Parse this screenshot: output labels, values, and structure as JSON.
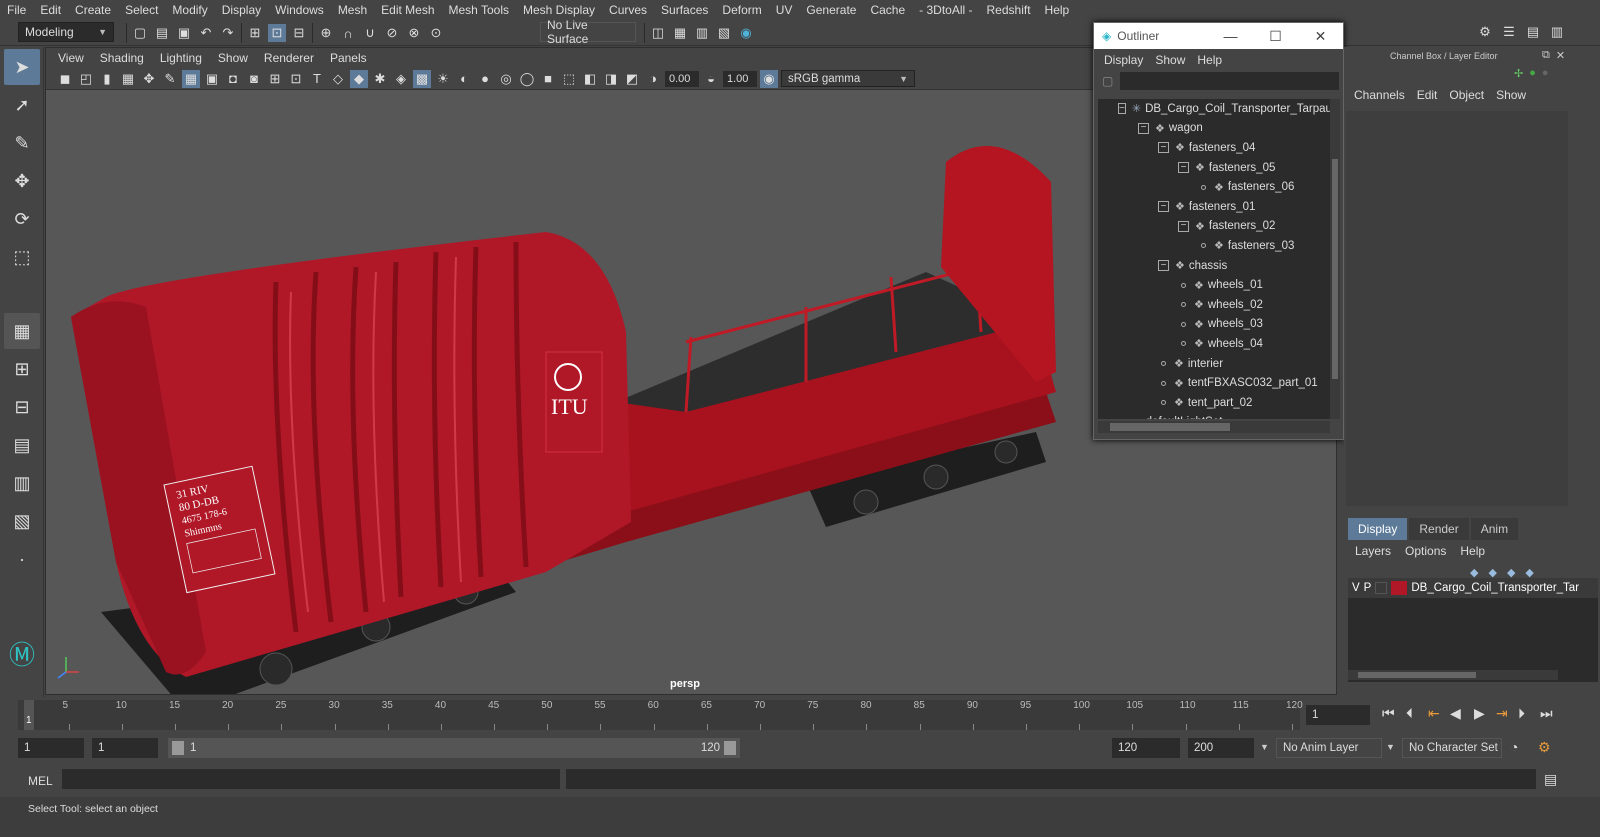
{
  "menubar": {
    "items": [
      "File",
      "Edit",
      "Create",
      "Select",
      "Modify",
      "Display",
      "Windows",
      "Mesh",
      "Edit Mesh",
      "Mesh Tools",
      "Mesh Display",
      "Curves",
      "Surfaces",
      "Deform",
      "UV",
      "Generate",
      "Cache",
      "- 3DtoAll -",
      "Redshift",
      "Help"
    ]
  },
  "shelf": {
    "mode": "Modeling",
    "live_surface": "No Live Surface"
  },
  "viewport": {
    "menu": [
      "View",
      "Shading",
      "Lighting",
      "Show",
      "Renderer",
      "Panels"
    ],
    "exposure": "0.00",
    "gamma": "1.00",
    "color_space": "sRGB gamma",
    "camera_label": "persp",
    "decal_lines": [
      "31 RIV",
      "80 D-DB",
      "4675 178-6",
      "Shimmns"
    ],
    "logo_text": "ITU"
  },
  "outliner": {
    "title": "Outliner",
    "menu": [
      "Display",
      "Show",
      "Help"
    ],
    "tree": [
      {
        "label": "DB_Cargo_Coil_Transporter_Tarpau",
        "depth": 0,
        "kind": "box",
        "icon": "asterisk"
      },
      {
        "label": "wagon",
        "depth": 1,
        "kind": "box",
        "icon": "group"
      },
      {
        "label": "fasteners_04",
        "depth": 2,
        "kind": "box",
        "icon": "group"
      },
      {
        "label": "fasteners_05",
        "depth": 3,
        "kind": "box",
        "icon": "group"
      },
      {
        "label": "fasteners_06",
        "depth": 4,
        "kind": "dot",
        "icon": "group"
      },
      {
        "label": "fasteners_01",
        "depth": 2,
        "kind": "box",
        "icon": "group"
      },
      {
        "label": "fasteners_02",
        "depth": 3,
        "kind": "box",
        "icon": "group"
      },
      {
        "label": "fasteners_03",
        "depth": 4,
        "kind": "dot",
        "icon": "group"
      },
      {
        "label": "chassis",
        "depth": 2,
        "kind": "box",
        "icon": "group"
      },
      {
        "label": "wheels_01",
        "depth": 3,
        "kind": "dot",
        "icon": "group"
      },
      {
        "label": "wheels_02",
        "depth": 3,
        "kind": "dot",
        "icon": "group"
      },
      {
        "label": "wheels_03",
        "depth": 3,
        "kind": "dot",
        "icon": "group"
      },
      {
        "label": "wheels_04",
        "depth": 3,
        "kind": "dot",
        "icon": "group"
      },
      {
        "label": "interier",
        "depth": 2,
        "kind": "dot",
        "icon": "group"
      },
      {
        "label": "tentFBXASC032_part_01",
        "depth": 2,
        "kind": "dot",
        "icon": "group"
      },
      {
        "label": "tent_part_02",
        "depth": 2,
        "kind": "dot",
        "icon": "group"
      },
      {
        "label": "defaultLightSet",
        "depth": 0,
        "kind": "none",
        "icon": "light"
      }
    ]
  },
  "channelbox": {
    "title": "Channel Box / Layer Editor",
    "menu": [
      "Channels",
      "Edit",
      "Object",
      "Show"
    ]
  },
  "layer_editor": {
    "tabs": [
      "Display",
      "Render",
      "Anim"
    ],
    "active_tab": "Display",
    "menu": [
      "Layers",
      "Options",
      "Help"
    ],
    "layer": {
      "v": "V",
      "p": "P",
      "name": "DB_Cargo_Coil_Transporter_Tar",
      "color": "#b01828"
    }
  },
  "timeline": {
    "ticks": [
      "5",
      "10",
      "15",
      "20",
      "25",
      "30",
      "35",
      "40",
      "45",
      "50",
      "55",
      "60",
      "65",
      "70",
      "75",
      "80",
      "85",
      "90",
      "95",
      "100",
      "105",
      "110",
      "115",
      "120"
    ],
    "current_frame_marker": "1",
    "current_frame": "1"
  },
  "range": {
    "start": "1",
    "anim_start": "1",
    "slider_start": "1",
    "slider_end": "120",
    "end": "120",
    "anim_end": "200",
    "anim_layer": "No Anim Layer",
    "char_set": "No Character Set"
  },
  "mel": {
    "label": "MEL"
  },
  "status": {
    "text": "Select Tool: select an object"
  },
  "colors": {
    "accent": "#5d7a99",
    "wagon": "#b01828"
  }
}
